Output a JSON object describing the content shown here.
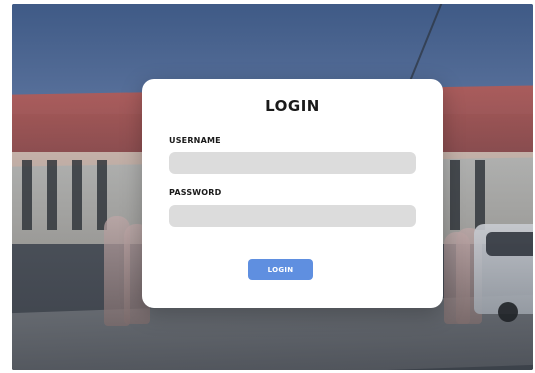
{
  "colors": {
    "card_bg": "#ffffff",
    "input_bg": "#dcdcdc",
    "button_bg": "#5f8fe0",
    "title_text": "#1a1a1a",
    "overlay_tint": "#3a4c6b"
  },
  "login": {
    "title": "LOGIN",
    "username_label": "USERNAME",
    "username_value": "",
    "username_placeholder": "",
    "password_label": "PASSWORD",
    "password_value": "",
    "password_placeholder": "",
    "button_label": "LOGIN"
  }
}
